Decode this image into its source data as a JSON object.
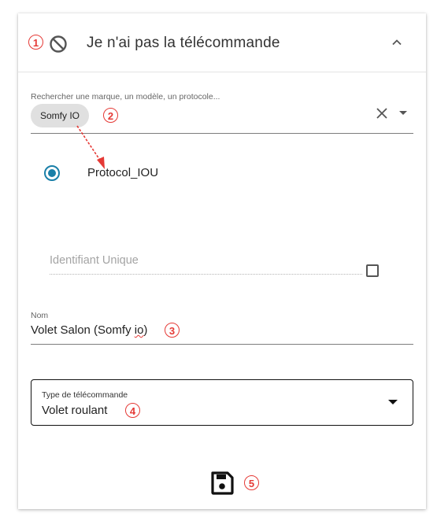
{
  "header": {
    "title": "Je n'ai pas la télécommande",
    "icon": "block-icon",
    "expand_icon": "chevron-up-icon"
  },
  "search": {
    "label": "Rechercher une marque, un modèle, un protocole...",
    "chip": "Somfy IO",
    "clear_icon": "close-icon",
    "dropdown_icon": "arrow-drop-down-icon"
  },
  "protocol": {
    "label": "Protocol_IOU",
    "selected": true
  },
  "identifier": {
    "placeholder": "Identifiant Unique",
    "checked": false
  },
  "name_field": {
    "label": "Nom",
    "value_main": "Volet Salon (Somfy ",
    "value_squiggle": "io",
    "value_end": ")"
  },
  "remote_type": {
    "label": "Type de télécommande",
    "value": "Volet roulant"
  },
  "save": {
    "icon": "save-icon"
  },
  "annotations": [
    "1",
    "2",
    "3",
    "4",
    "5"
  ],
  "colors": {
    "annotation": "#e53935",
    "radio": "#1a7fa8",
    "chip_bg": "#e0e0e0"
  }
}
